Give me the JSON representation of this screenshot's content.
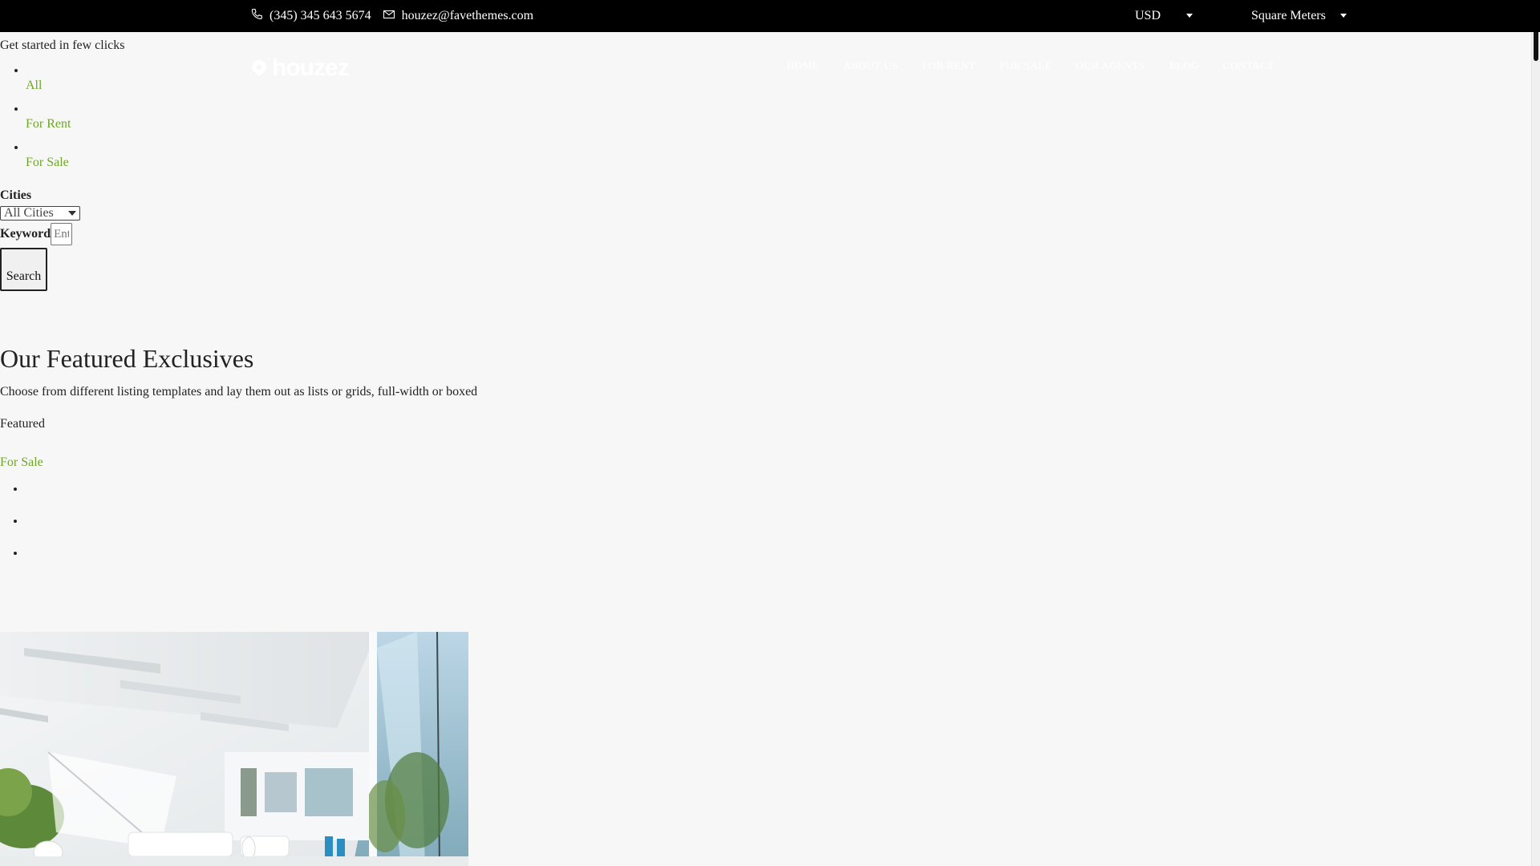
{
  "topbar": {
    "phone": "(345) 345 643 5674",
    "email": "houzez@favethemes.com",
    "currency": "USD",
    "area_unit": "Square Meters"
  },
  "brand": {
    "logo_text": "houzez"
  },
  "nav": {
    "items": [
      "HOME",
      "ABOUT US",
      "FOR RENT",
      "FOR SALE",
      "OUR AGENTS",
      "BLOG",
      "CONTACT"
    ]
  },
  "hero": {
    "tagline": "Get started in few clicks",
    "status_tabs": [
      "All",
      "For Rent",
      "For Sale"
    ]
  },
  "search": {
    "cities_label": "Cities",
    "cities_value": "All Cities",
    "keyword_label": "Keyword",
    "keyword_placeholder": "Enter Keyword...",
    "submit_label": "Search"
  },
  "featured": {
    "title": "Our Featured Exclusives",
    "subtitle": "Choose from different listing templates and lay them out as lists or grids, full-width or boxed",
    "badge": "Featured",
    "status_link": "For Sale"
  },
  "colors": {
    "accent_green": "#6fa52b",
    "topbar_bg": "#000000",
    "page_bg": "#f7f7f7"
  },
  "icons": {
    "phone": "phone-icon",
    "email": "envelope-icon",
    "logo": "houzez-logo-mark"
  }
}
